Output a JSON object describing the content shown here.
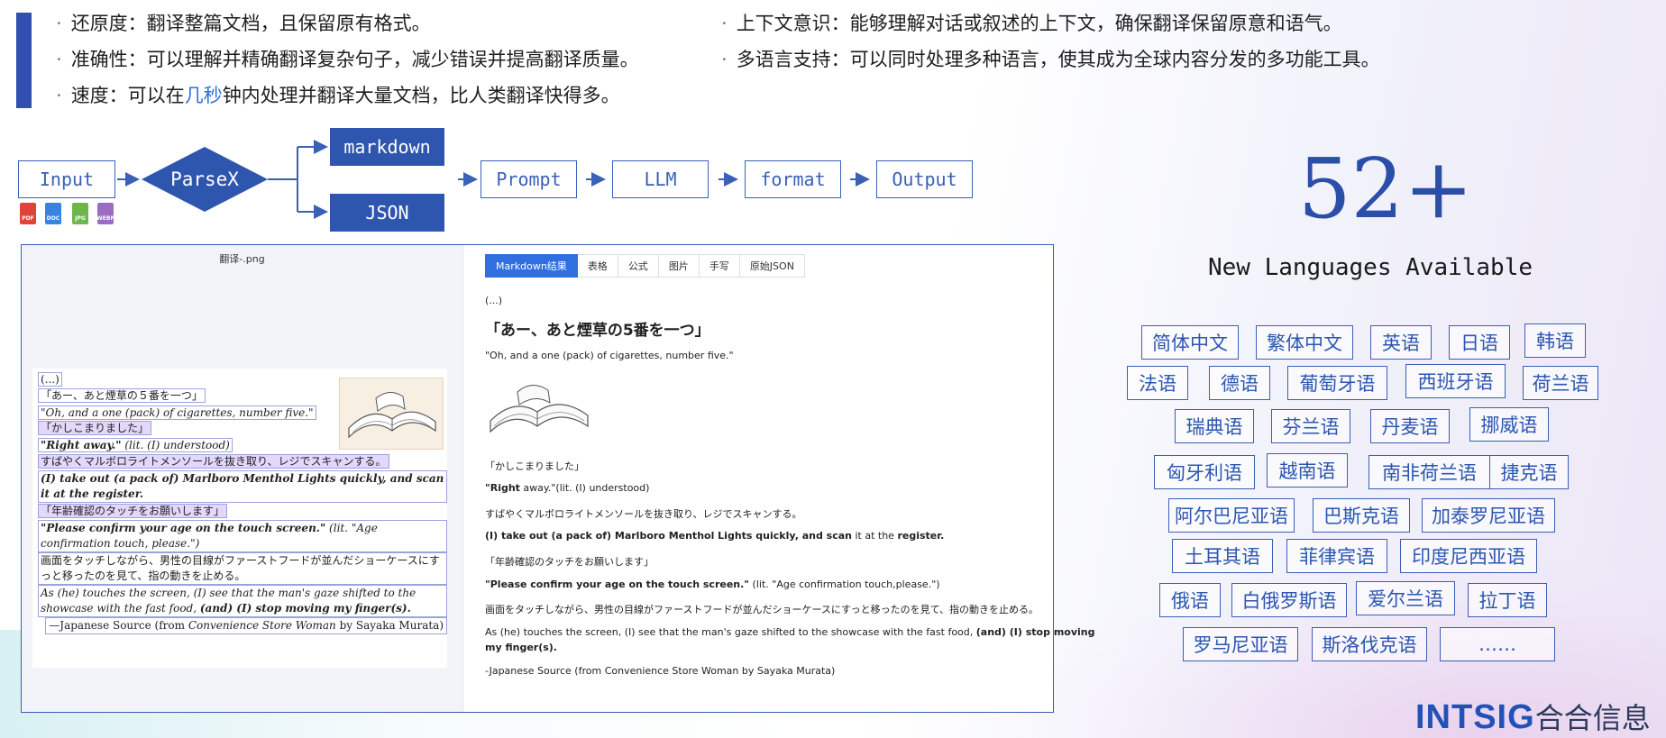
{
  "bullets_left": [
    {
      "pre": "还原度：翻译整篇文档，且保留原有格式。",
      "hl": "",
      "post": ""
    },
    {
      "pre": "准确性：可以理解并精确翻译复杂句子，减少错误并提高翻译质量。",
      "hl": "",
      "post": ""
    },
    {
      "pre": "速度：可以在",
      "hl": "几秒",
      "post": "钟内处理并翻译大量文档，比人类翻译快得多。"
    }
  ],
  "bullets_right": [
    "上下文意识：能够理解对话或叙述的上下文，确保翻译保留原意和语气。",
    "多语言支持：可以同时处理多种语言，使其成为全球内容分发的多功能工具。"
  ],
  "bullet_dot": "·",
  "flow": {
    "input": "Input",
    "parser": "ParseX",
    "markdown": "markdown",
    "json": "JSON",
    "prompt": "Prompt",
    "llm": "LLM",
    "format": "format",
    "output": "Output",
    "file_icons": [
      "PDF",
      "DOC",
      "JPG",
      "WEBP"
    ]
  },
  "panel": {
    "filename": "翻译-.png",
    "tabs": [
      "Markdown结果",
      "表格",
      "公式",
      "图片",
      "手写",
      "原始JSON"
    ],
    "doc_lines": {
      "l1": "(...)",
      "l2": "「あー、あと煙草の５番を一つ」",
      "l3": "\"Oh, and a one (pack) of cigarettes, number five.\"",
      "l4": "「かしこまりました」",
      "l5a": "\"Right away.\"",
      "l5b": " (lit. (I) understood)",
      "l6": "すばやくマルボロライトメンソールを抜き取り、レジでスキャンする。",
      "l7": "(I) take out (a pack of) Marlboro Menthol Lights quickly, and scan it at the register.",
      "l8": "「年齢確認のタッチをお願いします」",
      "l9a": "\"Please confirm your age on the touch screen.\"",
      "l9b": " (lit. \"Age confirmation touch, please.\")",
      "l10": "画面をタッチしながら、男性の目線がファーストフードが並んだショーケースにすっと移ったのを見て、指の動きを止める。",
      "l11a": "As (he) touches the screen, (I) see that the man's gaze shifted to the showcase with the fast food, ",
      "l11b": "(and) (I) stop moving my finger(s).",
      "l12a": "—Japanese Source (from ",
      "l12b": "Convenience Store Woman",
      "l12c": " by Sayaka Murata)"
    },
    "md_lines": {
      "m1": "(...)",
      "m2": "「あー、あと煙草の5番を一つ」",
      "m3": "\"Oh, and a one (pack) of cigarettes, number five.\"",
      "m4": "「かしこまりました」",
      "m5a": "\"Right",
      "m5b": " away.\"(lit. (I) understood)",
      "m6": "すばやくマルボロライトメンソールを抜き取り、レジでスキャンする。",
      "m7a": "(I) take out (a pack of) Marlboro Menthol Lights quickly, and scan",
      "m7b": " it at the ",
      "m7c": "register.",
      "m8": "「年齢確認のタッチをお願いします」",
      "m9a": "\"Please confirm your age on the touch screen.\"",
      "m9b": " (lit. \"Age confirmation touch,please.\")",
      "m10": "画面をタッチしながら、男性の目線がファーストフードが並んだショーケースにすっと移ったのを見て、指の動きを止める。",
      "m11a": "As (he) touches the screen, (I) see that the man's gaze shifted to the showcase with the fast food, ",
      "m11b": "(and) (I) stop moving",
      "m11c": "my finger(s).",
      "m12": "-Japanese Source (from Convenience Store Woman by Sayaka Murata)"
    }
  },
  "stat": {
    "number": "52+",
    "label": "New Languages Available"
  },
  "languages": [
    "简体中文",
    "繁体中文",
    "英语",
    "日语",
    "韩语",
    "法语",
    "德语",
    "葡萄牙语",
    "西班牙语",
    "荷兰语",
    "瑞典语",
    "芬兰语",
    "丹麦语",
    "挪威语",
    "匈牙利语",
    "越南语",
    "南非荷兰语",
    "捷克语",
    "阿尔巴尼亚语",
    "巴斯克语",
    "加泰罗尼亚语",
    "土耳其语",
    "菲律宾语",
    "印度尼西亚语",
    "俄语",
    "白俄罗斯语",
    "爱尔兰语",
    "拉丁语",
    "罗马尼亚语",
    "斯洛伐克语",
    "……"
  ],
  "brand": {
    "latin": "INTSIG",
    "cn": "合合信息"
  },
  "colors": {
    "accent": "#2f56ae",
    "tab_active": "#2f6fe0",
    "highlight": "#2f6fd8"
  }
}
